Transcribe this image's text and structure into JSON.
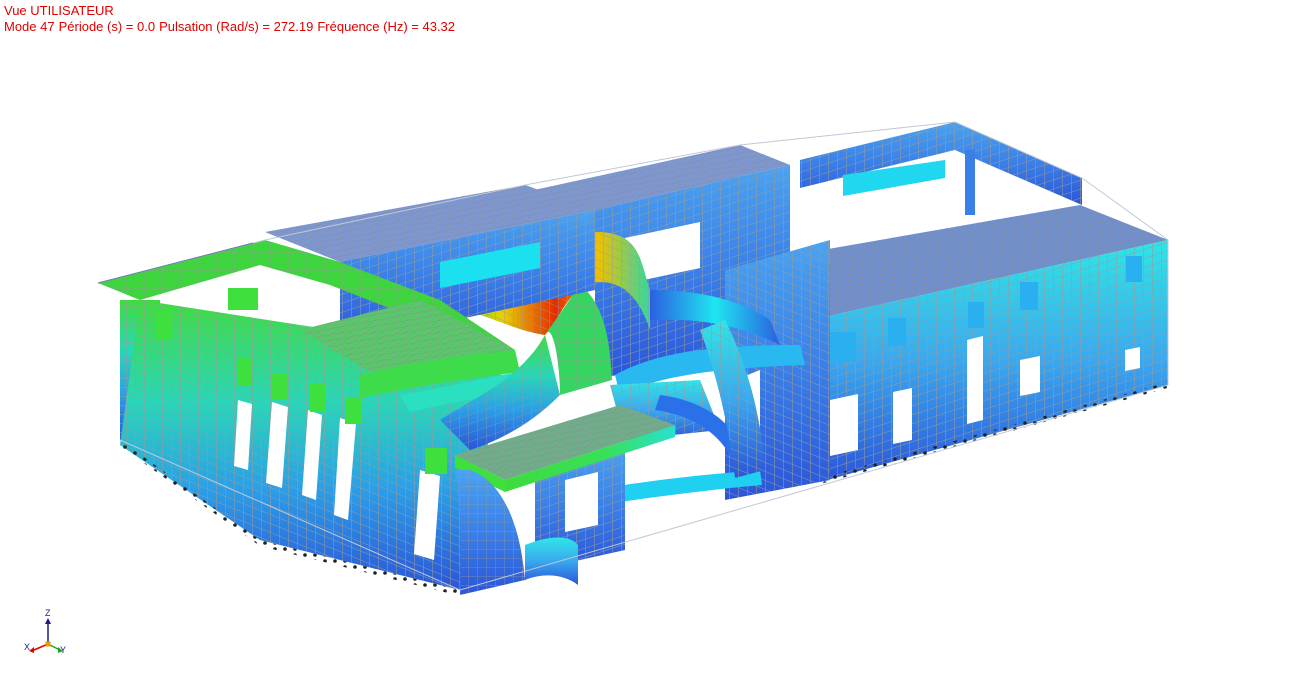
{
  "view": {
    "title": "Vue UTILISATEUR"
  },
  "mode_info": {
    "mode": "Mode 47",
    "period": "Période (s) = 0.0",
    "pulsation": "Pulsation (Rad/s) = 272.19",
    "frequency": "Fréquence (Hz) = 43.32"
  },
  "colors": {
    "overlay_text": "#e00000",
    "low": "#2f5fe0",
    "mid_low": "#1ad4f0",
    "mid": "#33d633",
    "high": "#f0e000",
    "peak": "#e02000",
    "mesh": "#b0b0b0",
    "support": "#202020"
  },
  "triad": {
    "z": "Z",
    "x": "X",
    "y": "Y"
  }
}
